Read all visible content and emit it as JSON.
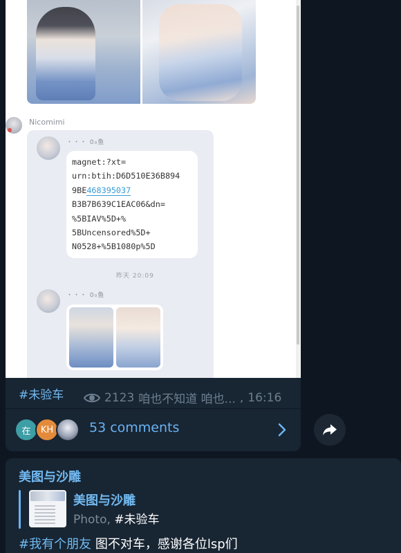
{
  "post": {
    "photo": {
      "sender_name": "Nicomimi",
      "inner_name_1": "・・・ 0₀鱼",
      "inner_name_2": "・・・ 0₀鱼",
      "magnet_before_link": "magnet:?xt=\nurn:btih:D6D510E36B894\n9BE",
      "magnet_link": "468395037",
      "magnet_after_link": "\nB3B7B639C1EAC06&dn=\n%5BIAV%5D+%\n5BUncensored%5D+\nN0528+%5B1080p%5D",
      "inner_timestamp": "昨天 20:09"
    },
    "hashtag": "#未验车",
    "views": "2123",
    "author": "咱也不知道 咱也...",
    "time": "16:16",
    "comment_avatars": [
      "在",
      "KH",
      ""
    ],
    "comments_label": "53 comments"
  },
  "reply_post": {
    "channel_title": "美图与沙雕",
    "quote_title": "美图与沙雕",
    "quote_sub_prefix": "Photo, ",
    "quote_sub_tag": "#未验车",
    "text_tag": "#我有个朋友",
    "text_body": " 图不对车，感谢各位lsp们"
  },
  "colors": {
    "background": "#0e1621",
    "bubble": "#182533",
    "link": "#6ab3f3",
    "meta": "#6d7f8f"
  },
  "icons": [
    "eye-icon",
    "chevron-right-icon",
    "share-icon"
  ]
}
